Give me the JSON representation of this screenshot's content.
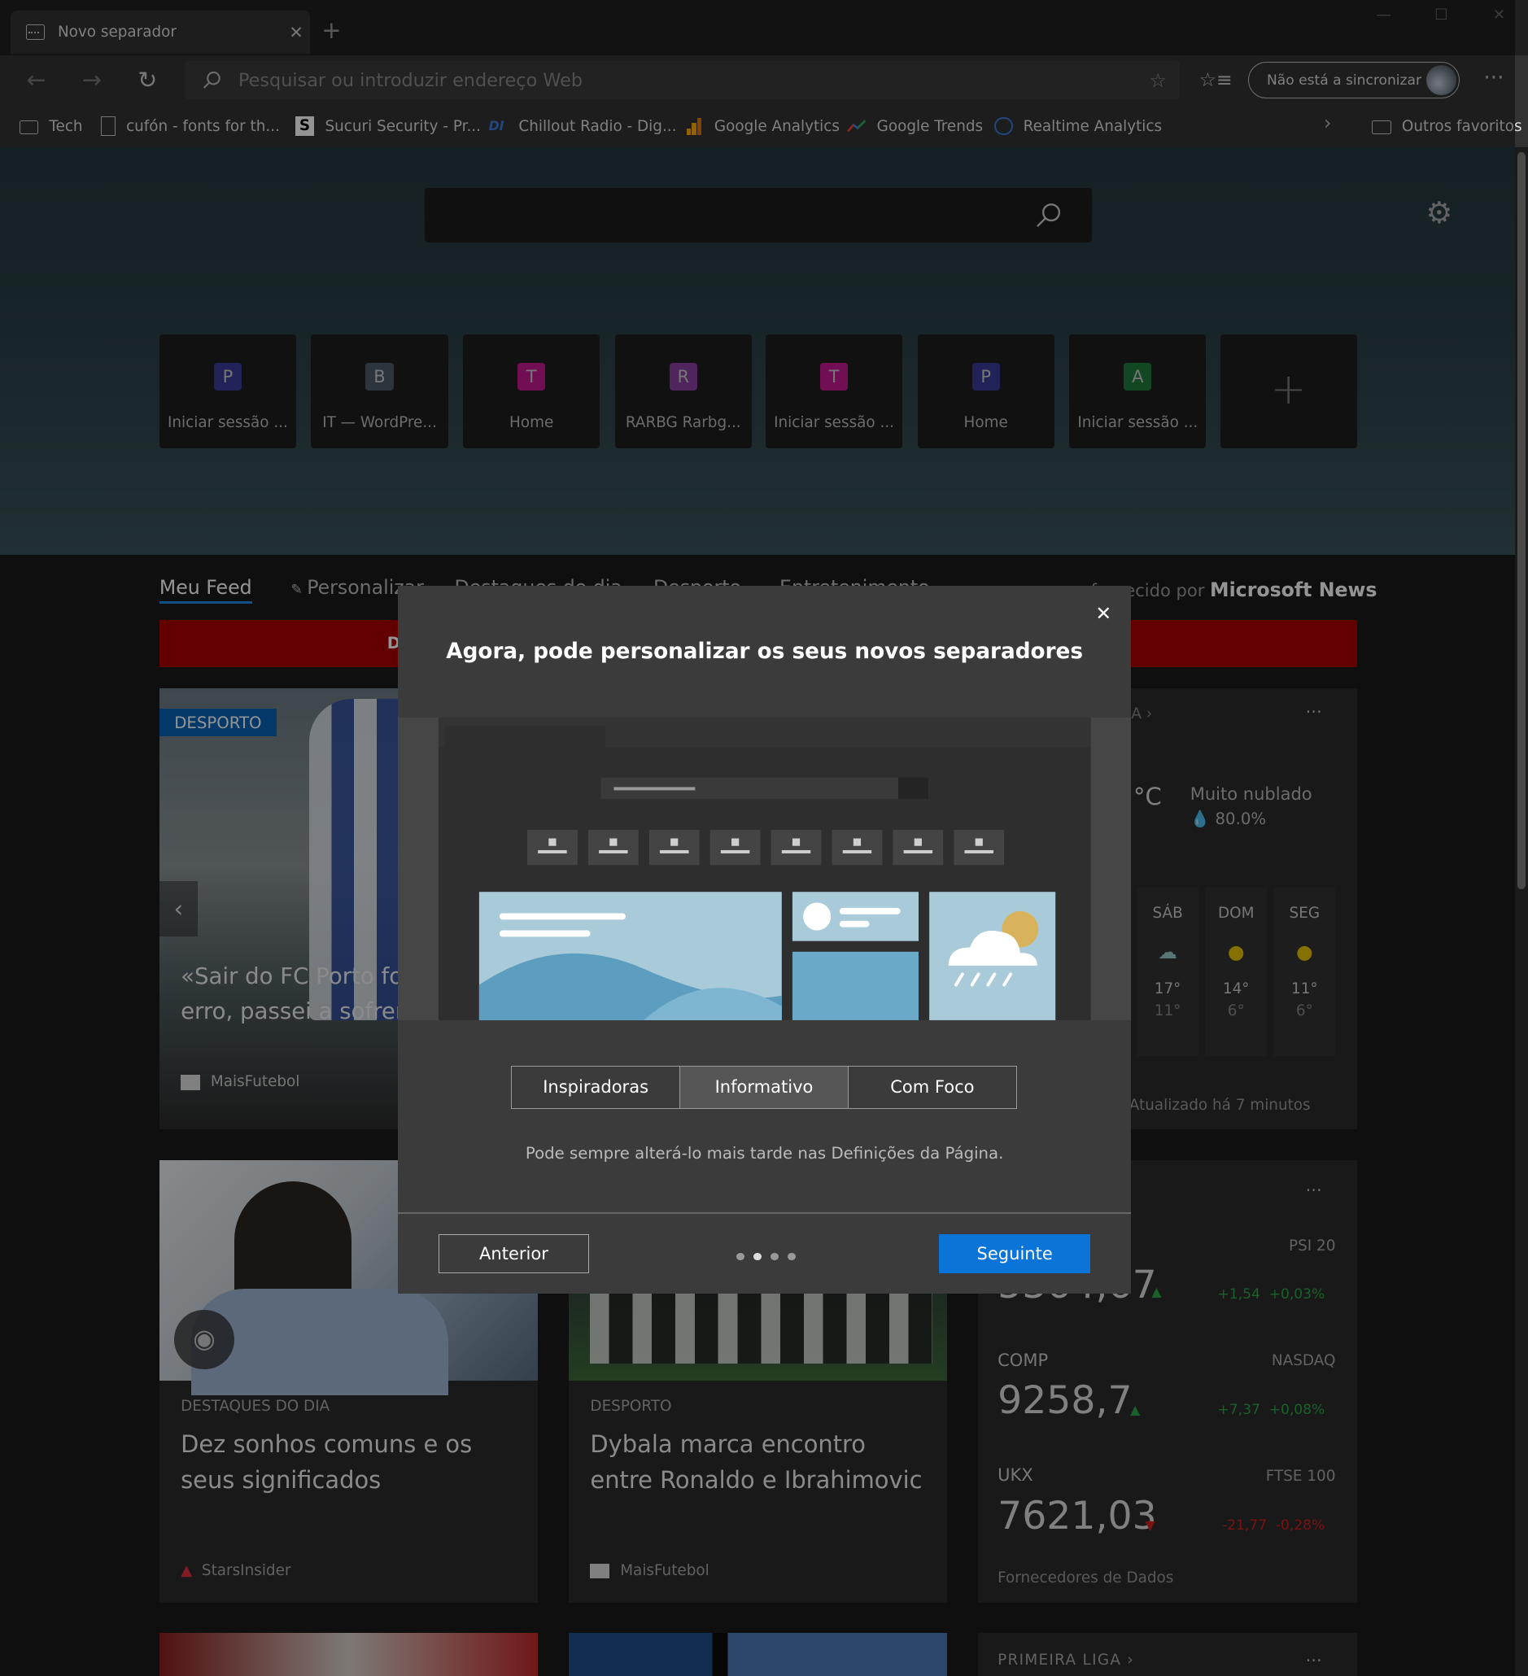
{
  "tab": {
    "title": "Novo separador",
    "close": "✕",
    "new": "+"
  },
  "window": {
    "minimize": "—",
    "maximize": "☐",
    "close": "✕"
  },
  "toolbar": {
    "back": "←",
    "forward": "→",
    "reload": "↻",
    "address_placeholder": "Pesquisar ou introduzir endereço Web",
    "fav_star": "☆",
    "favorites": "☆≡",
    "sync": "Não está a sincronizar",
    "more": "···"
  },
  "favorites": [
    {
      "label": "Tech",
      "icon": "folder-icon"
    },
    {
      "label": "cufón - fonts for th...",
      "icon": "page-icon"
    },
    {
      "label": "Sucuri Security - Pr...",
      "icon": "sucuri-icon"
    },
    {
      "label": "Chillout Radio - Dig...",
      "icon": "di-icon"
    },
    {
      "label": "Google Analytics",
      "icon": "analytics-icon"
    },
    {
      "label": "Google Trends",
      "icon": "trends-icon"
    },
    {
      "label": "Realtime Analytics",
      "icon": "clock-icon"
    }
  ],
  "favorites_more": "›",
  "other_favorites": "Outros favoritos",
  "gear": "⚙",
  "tiles": [
    {
      "letter": "P",
      "label": "Iniciar sessão ...",
      "color": "#3a3c98"
    },
    {
      "letter": "B",
      "label": "IT — WordPre...",
      "color": "#4c5a6a"
    },
    {
      "letter": "T",
      "label": "Home",
      "color": "#c4198f"
    },
    {
      "letter": "R",
      "label": "RARBG Rarbg...",
      "color": "#8a3fa0"
    },
    {
      "letter": "T",
      "label": "Iniciar sessão ...",
      "color": "#c4198f"
    },
    {
      "letter": "P",
      "label": "Home",
      "color": "#3a3c98"
    },
    {
      "letter": "A",
      "label": "Iniciar sessão ...",
      "color": "#1e7b3c"
    }
  ],
  "add_tile": "+",
  "feed": {
    "nav": [
      "Meu Feed",
      "Personalizar",
      "Destaques do dia",
      "Desporto",
      "Entretenimento"
    ],
    "provided_by": "fornecido por",
    "brand": "Microsoft News",
    "banner_letter": "D",
    "hero_card": {
      "badge": "DESPORTO",
      "title": "«Sair do FC Porto foi o maior erro, passei a sofrer muito»",
      "source": "MaisFutebol"
    },
    "weather": {
      "location_partial": "A ›",
      "unit": "°C",
      "condition": "Muito nublado",
      "humidity": "80.0%",
      "days": [
        {
          "day": "SÁB",
          "hi": "17°",
          "lo": "11°"
        },
        {
          "day": "DOM",
          "hi": "14°",
          "lo": "6°"
        },
        {
          "day": "SEG",
          "hi": "11°",
          "lo": "6°"
        }
      ],
      "updated": "Atualizado há 7 minutos"
    },
    "cards": [
      {
        "category": "DESTAQUES DO DIA",
        "title": "Dez sonhos comuns e os seus significados",
        "source": "StarsInsider"
      },
      {
        "category": "DESPORTO",
        "title": "Dybala marca encontro entre Ronaldo e Ibrahimovic",
        "source": "MaisFutebol"
      }
    ],
    "markets": {
      "rows": [
        {
          "code": "",
          "name": "PSI 20",
          "value": "5364,67",
          "change": "+1,54",
          "pct": "+0,03%",
          "dir": "up"
        },
        {
          "code": "COMP",
          "name": "NASDAQ",
          "value": "9258,7",
          "change": "+7,37",
          "pct": "+0,08%",
          "dir": "up"
        },
        {
          "code": "UKX",
          "name": "FTSE 100",
          "value": "7621,03",
          "change": "-21,77",
          "pct": "-0,28%",
          "dir": "down"
        }
      ],
      "footer": "Fornecedores de Dados"
    },
    "league": "PRIMEIRA LIGA ›"
  },
  "dialog": {
    "title": "Agora, pode personalizar os seus novos separadores",
    "options": [
      "Inspiradoras",
      "Informativo",
      "Com Foco"
    ],
    "selected": 1,
    "hint": "Pode sempre alterá-lo mais tarde nas Definições da Página.",
    "prev": "Anterior",
    "next": "Seguinte",
    "close": "✕"
  }
}
